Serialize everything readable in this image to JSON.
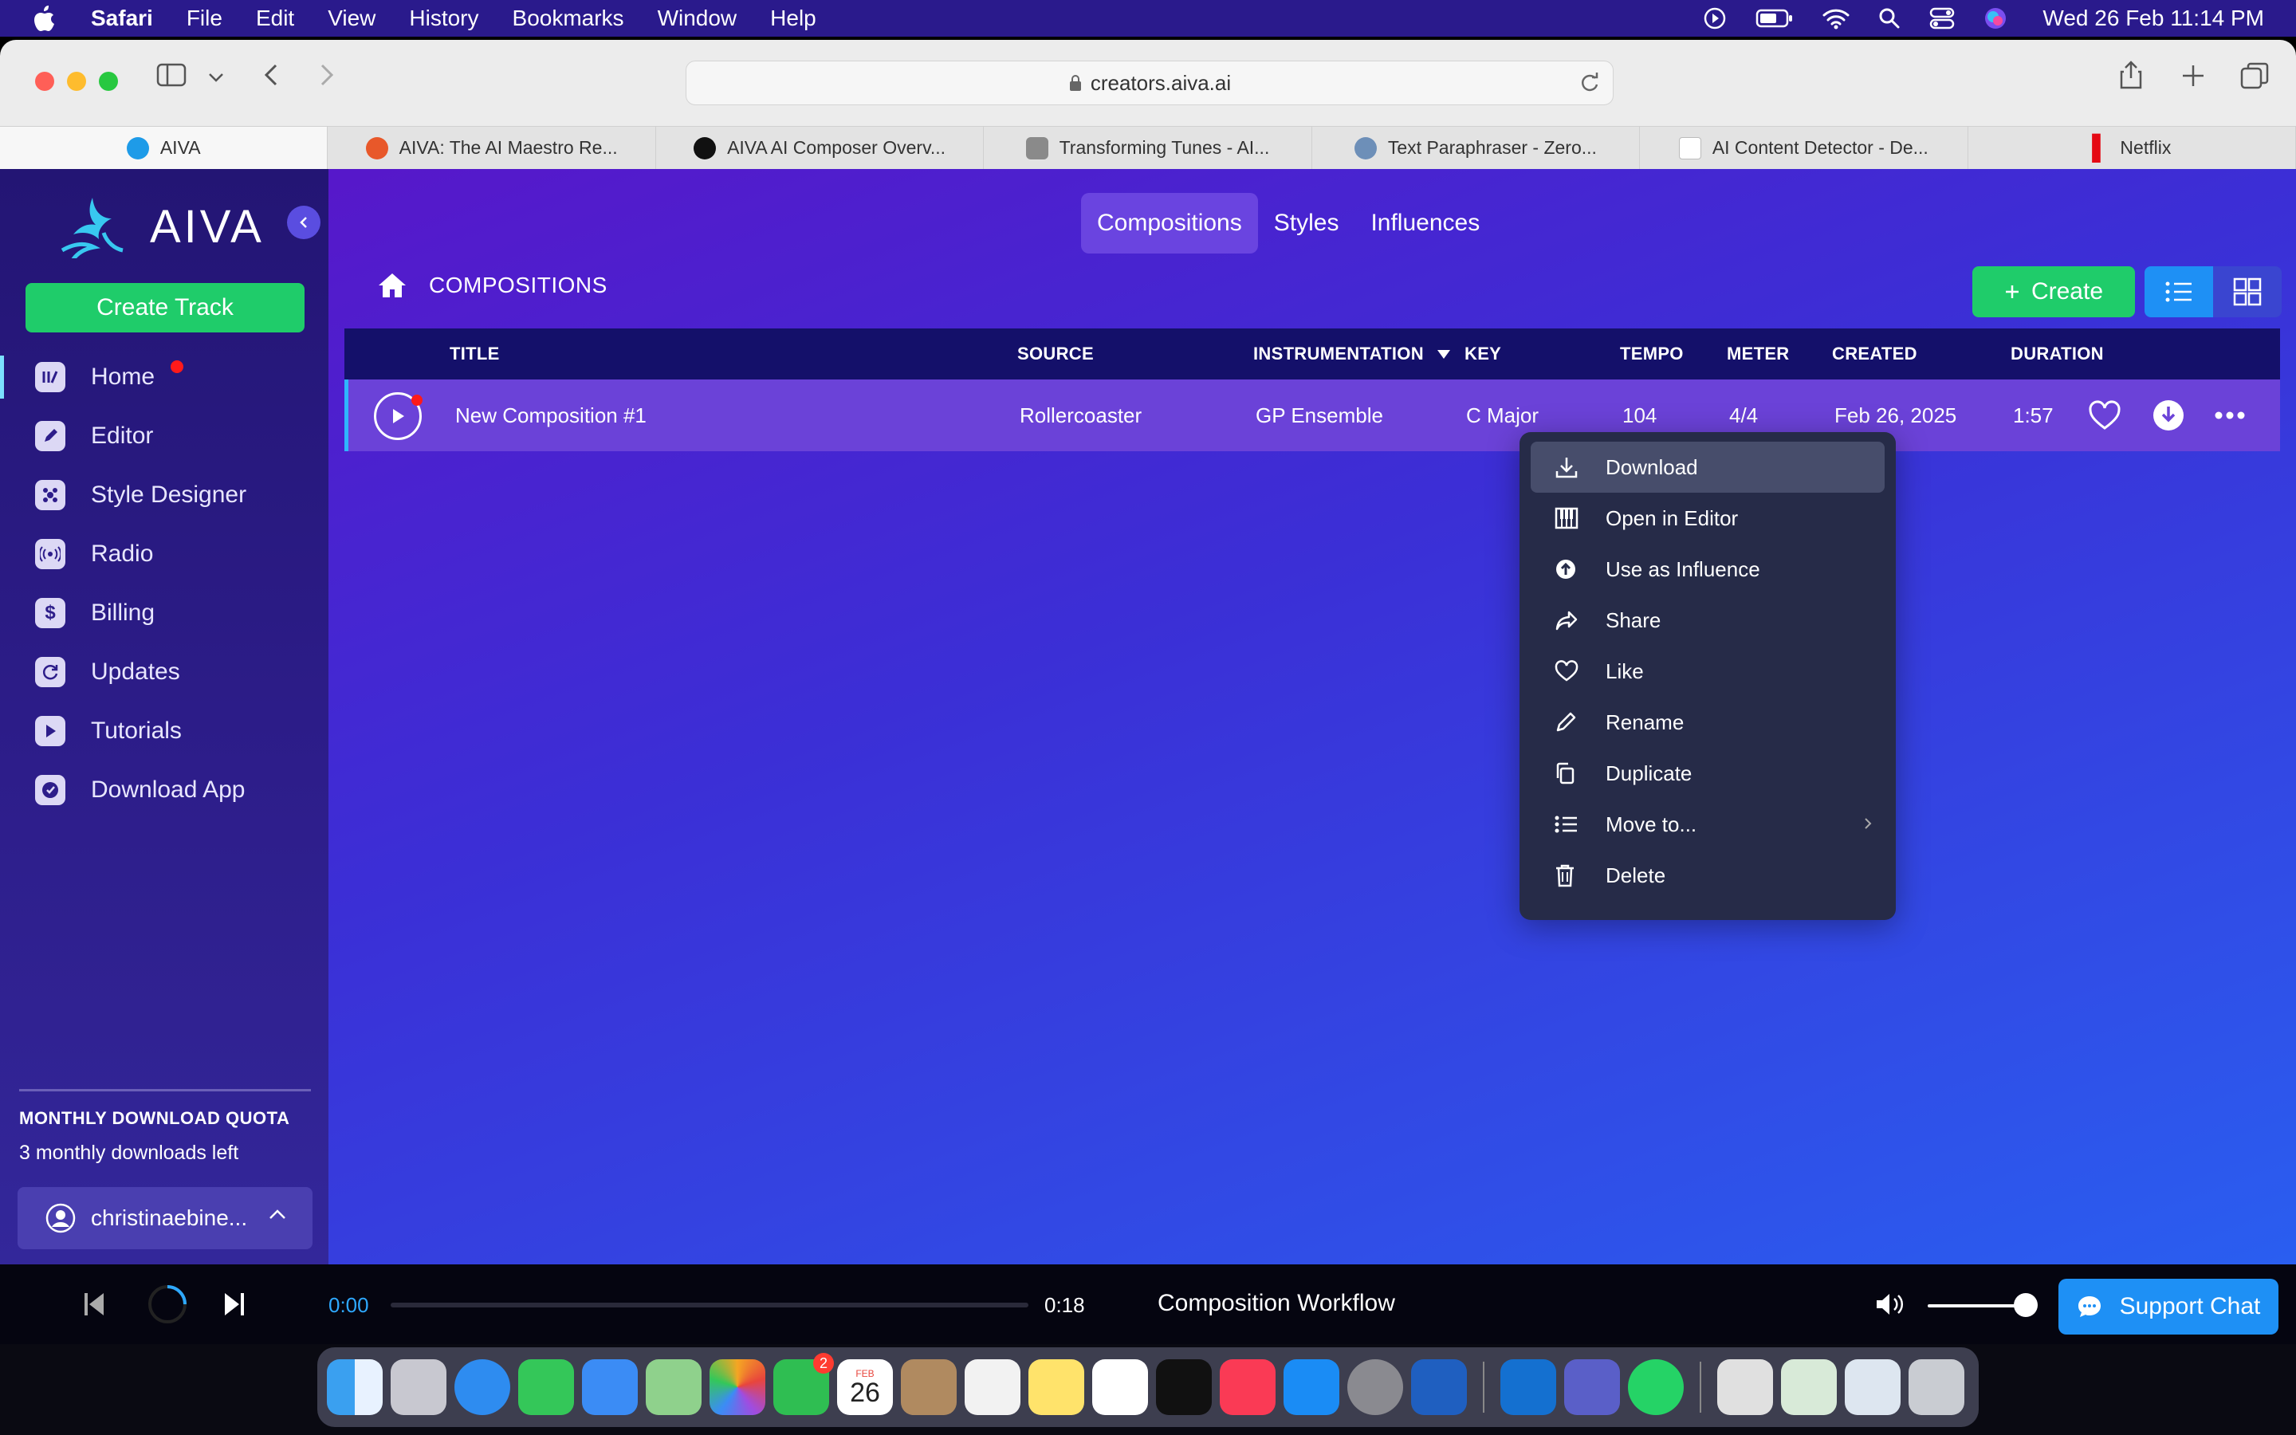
{
  "menubar": {
    "items": [
      "Safari",
      "File",
      "Edit",
      "View",
      "History",
      "Bookmarks",
      "Window",
      "Help"
    ],
    "clock": "Wed 26 Feb  11:14 PM"
  },
  "browser": {
    "url": "creators.aiva.ai",
    "tabs": [
      {
        "label": "AIVA",
        "color": "#1e9be8"
      },
      {
        "label": "AIVA: The AI Maestro Re...",
        "color": "#e8582a"
      },
      {
        "label": "AIVA AI Composer Overv...",
        "color": "#111111"
      },
      {
        "label": "Transforming Tunes - AI...",
        "color": "#8a8a8a"
      },
      {
        "label": "Text Paraphraser - Zero...",
        "color": "#6d8fb8"
      },
      {
        "label": "AI Content Detector - De...",
        "color": "#c0c0c0"
      },
      {
        "label": "Netflix",
        "color": "#e50914"
      }
    ]
  },
  "sidebar": {
    "logo": "AIVA",
    "create_track": "Create Track",
    "items": [
      {
        "label": "Home"
      },
      {
        "label": "Editor"
      },
      {
        "label": "Style Designer"
      },
      {
        "label": "Radio"
      },
      {
        "label": "Billing"
      },
      {
        "label": "Updates"
      },
      {
        "label": "Tutorials"
      },
      {
        "label": "Download App"
      }
    ],
    "quota_title": "MONTHLY DOWNLOAD QUOTA",
    "quota_text": "3 monthly downloads left",
    "user": "christinaebine..."
  },
  "main": {
    "tabs": [
      "Compositions",
      "Styles",
      "Influences"
    ],
    "breadcrumb": "COMPOSITIONS",
    "create": "Create",
    "columns": {
      "title": "TITLE",
      "source": "SOURCE",
      "instrumentation": "INSTRUMENTATION",
      "key": "KEY",
      "tempo": "TEMPO",
      "meter": "METER",
      "created": "CREATED",
      "duration": "DURATION"
    },
    "row": {
      "title": "New Composition #1",
      "source": "Rollercoaster",
      "instrumentation": "GP Ensemble",
      "key": "C Major",
      "tempo": "104",
      "meter": "4/4",
      "created": "Feb 26, 2025",
      "duration": "1:57"
    }
  },
  "context_menu": {
    "items": [
      "Download",
      "Open in Editor",
      "Use as Influence",
      "Share",
      "Like",
      "Rename",
      "Duplicate",
      "Move to...",
      "Delete"
    ]
  },
  "player": {
    "current": "0:00",
    "total": "0:18",
    "track": "Composition Workflow",
    "volume": 0.8,
    "support": "Support Chat"
  },
  "dock": {
    "calendar_month": "FEB",
    "calendar_day": "26",
    "facetime_badge": "2"
  }
}
